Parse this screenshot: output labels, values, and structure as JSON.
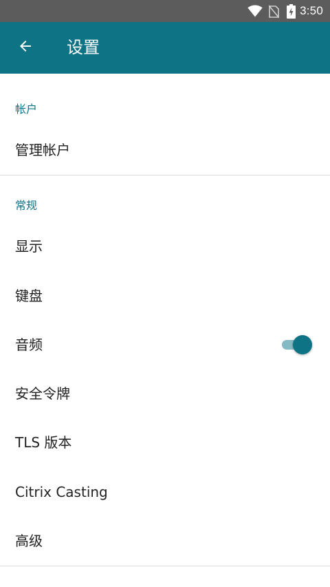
{
  "status_bar": {
    "time": "3:50",
    "icons": [
      "wifi-icon",
      "no-sim-icon",
      "battery-charging-icon"
    ]
  },
  "app_bar": {
    "back_icon": "arrow-left-icon",
    "title": "设置",
    "color": "#0d7385"
  },
  "sections": [
    {
      "header": "帐户",
      "items": [
        {
          "label": "管理帐户"
        }
      ]
    },
    {
      "header": "常规",
      "items": [
        {
          "label": "显示"
        },
        {
          "label": "键盘"
        },
        {
          "label": "音频",
          "toggle": true,
          "checked": true
        },
        {
          "label": "安全令牌"
        },
        {
          "label": "TLS 版本"
        },
        {
          "label": "Citrix Casting"
        },
        {
          "label": "高级"
        }
      ]
    }
  ],
  "colors": {
    "accent": "#0d7385",
    "status_bar": "#5c5c5c",
    "text": "#212121",
    "divider": "#dcdcdc"
  }
}
